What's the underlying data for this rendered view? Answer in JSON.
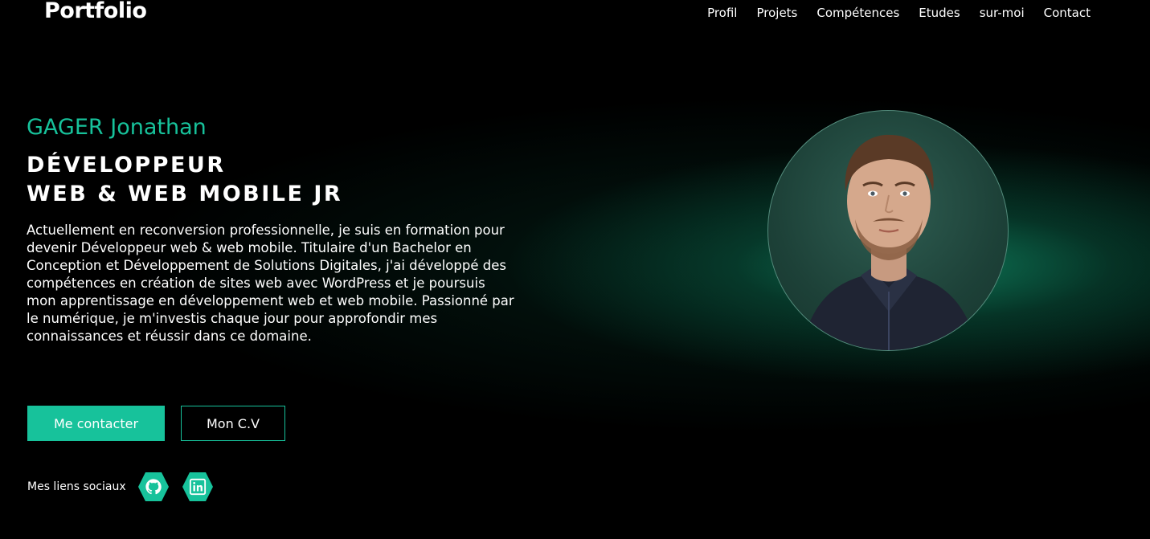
{
  "header": {
    "logo": "Portfolio",
    "nav": [
      "Profil",
      "Projets",
      "Compétences",
      "Etudes",
      "sur-moi",
      "Contact"
    ]
  },
  "hero": {
    "name": "GAGER Jonathan",
    "title_line1": "DÉVELOPPEUR",
    "title_line2": "WEB & WEB MOBILE JR",
    "description": "Actuellement en reconversion professionnelle, je suis en formation pour devenir Développeur web & web mobile. Titulaire d'un Bachelor en Conception et Développement de Solutions Digitales, j'ai développé des compétences en création de sites web avec WordPress et je poursuis mon apprentissage en développement web et web mobile. Passionné par le numérique, je m'investis chaque jour pour approfondir mes connaissances et réussir dans ce domaine.",
    "contact_button": "Me contacter",
    "cv_button": "Mon C.V"
  },
  "social": {
    "label": "Mes liens sociaux",
    "links": [
      {
        "icon": "github-icon"
      },
      {
        "icon": "linkedin-icon"
      }
    ]
  },
  "colors": {
    "accent": "#17c29b",
    "background": "#000000"
  }
}
